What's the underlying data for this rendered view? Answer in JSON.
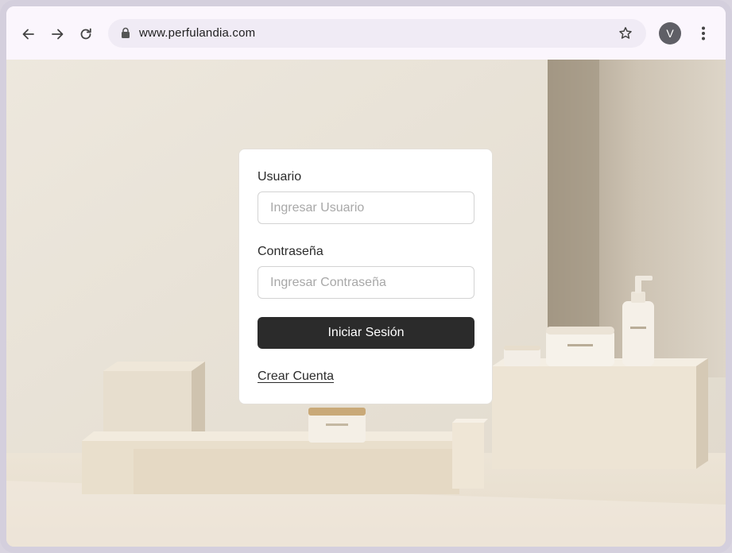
{
  "browser": {
    "back_icon": "arrow-left-icon",
    "forward_icon": "arrow-right-icon",
    "reload_icon": "reload-icon",
    "lock_icon": "lock-icon",
    "url": "www.perfulandia.com",
    "bookmark_icon": "star-icon",
    "profile_initial": "V",
    "menu_icon": "more-vert-icon"
  },
  "login": {
    "username_label": "Usuario",
    "username_placeholder": "Ingresar Usuario",
    "username_value": "",
    "password_label": "Contraseña",
    "password_placeholder": "Ingresar Contraseña",
    "password_value": "",
    "submit_label": "Iniciar Sesión",
    "create_account_label": "Crear Cuenta"
  },
  "colors": {
    "button_bg": "#2b2b2b",
    "toolbar_bg": "#fbf6fd",
    "omnibox_bg": "#f0ebf5",
    "avatar_bg": "#5f5f66"
  }
}
